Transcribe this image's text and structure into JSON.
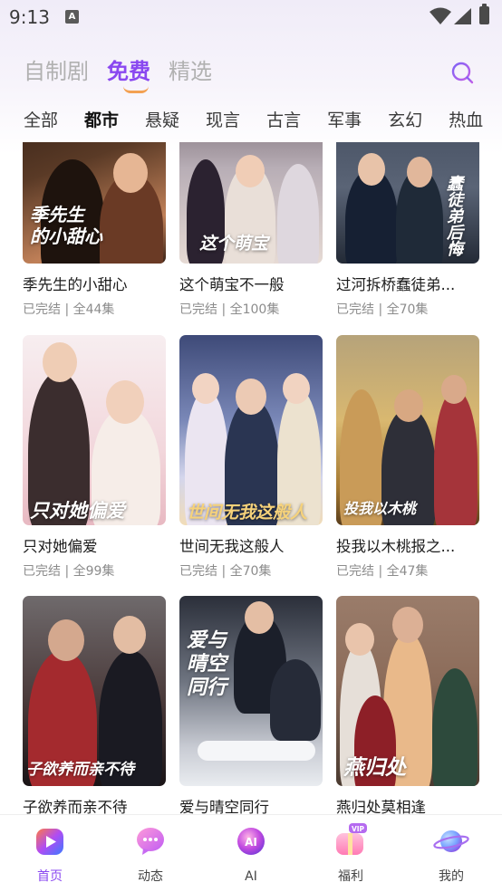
{
  "status_bar": {
    "time": "9:13",
    "notif_glyph": "A"
  },
  "main_tabs": [
    {
      "label": "自制剧",
      "active": false
    },
    {
      "label": "免费",
      "active": true
    },
    {
      "label": "精选",
      "active": false
    }
  ],
  "category_tabs": [
    {
      "label": "全部"
    },
    {
      "label": "都市",
      "active": true
    },
    {
      "label": "悬疑"
    },
    {
      "label": "现言"
    },
    {
      "label": "古言"
    },
    {
      "label": "军事"
    },
    {
      "label": "玄幻"
    },
    {
      "label": "热血"
    }
  ],
  "cards": [
    {
      "title": "季先生的小甜心",
      "meta": "已完结 | 全44集",
      "poster_text": "季先生\n的小甜心"
    },
    {
      "title": "这个萌宝不一般",
      "meta": "已完结 | 全100集",
      "poster_text": "这个萌宝"
    },
    {
      "title": "过河拆桥蠢徒弟...",
      "meta": "已完结 | 全70集",
      "poster_text": "蠢徒弟后悔"
    },
    {
      "title": "只对她偏爱",
      "meta": "已完结 | 全99集",
      "poster_text": "只对她偏爱"
    },
    {
      "title": "世间无我这般人",
      "meta": "已完结 | 全70集",
      "poster_text": "世间无我这般人"
    },
    {
      "title": "投我以木桃报之...",
      "meta": "已完结 | 全47集",
      "poster_text": "投我以木桃"
    },
    {
      "title": "子欲养而亲不待",
      "meta": "",
      "poster_text": "子欲养而亲不待"
    },
    {
      "title": "爱与晴空同行",
      "meta": "",
      "poster_text": "爱与\n晴空\n同行"
    },
    {
      "title": "燕归处莫相逢",
      "meta": "",
      "poster_text": "燕归处"
    }
  ],
  "bottom_nav": [
    {
      "label": "首页",
      "active": true,
      "icon": "home-play-icon"
    },
    {
      "label": "动态",
      "active": false,
      "icon": "chat-bubble-icon"
    },
    {
      "label": "AI",
      "active": false,
      "icon": "ai-orb-icon",
      "glyph": "AI"
    },
    {
      "label": "福利",
      "active": false,
      "icon": "vip-gift-icon",
      "glyph": "VIP"
    },
    {
      "label": "我的",
      "active": false,
      "icon": "planet-icon"
    }
  ],
  "colors": {
    "accent": "#8a48f0",
    "smile": "#f3a152"
  }
}
